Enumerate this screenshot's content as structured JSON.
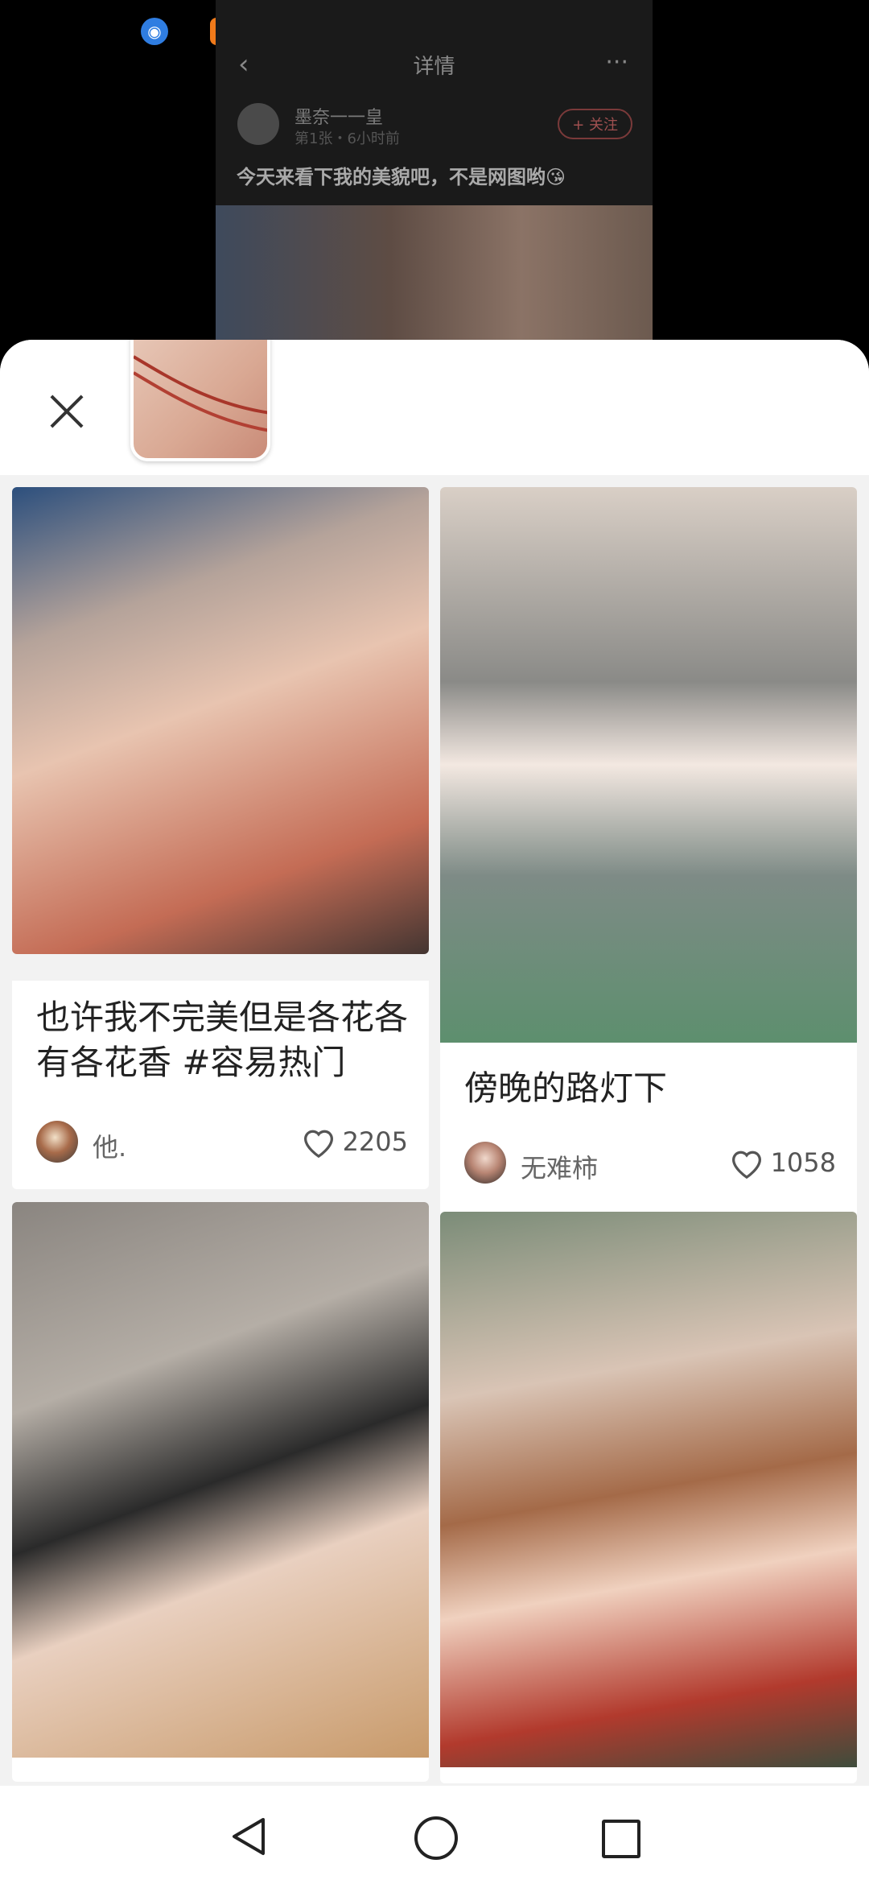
{
  "background_app": {
    "title": "详情",
    "user_name": "墨奈一一皇",
    "user_sub": "第1张・6小时前",
    "follow_label": "+ 关注",
    "post_text": "今天来看下我的美貌吧，不是网图哟😘"
  },
  "feed": [
    {
      "title": "也许我不完美但是各花各有各花香 #容易热门",
      "author": "他.",
      "likes": "2205"
    },
    {
      "title": "傍晚的路灯下",
      "author": "无难柿",
      "likes": "1058"
    },
    {
      "title": "",
      "author": "",
      "likes": ""
    },
    {
      "title": "",
      "author": "",
      "likes": ""
    }
  ],
  "colors": {
    "sheet_bg": "#f2f2f2",
    "card_bg": "#ffffff",
    "text_primary": "#222222",
    "text_secondary": "#666666"
  }
}
